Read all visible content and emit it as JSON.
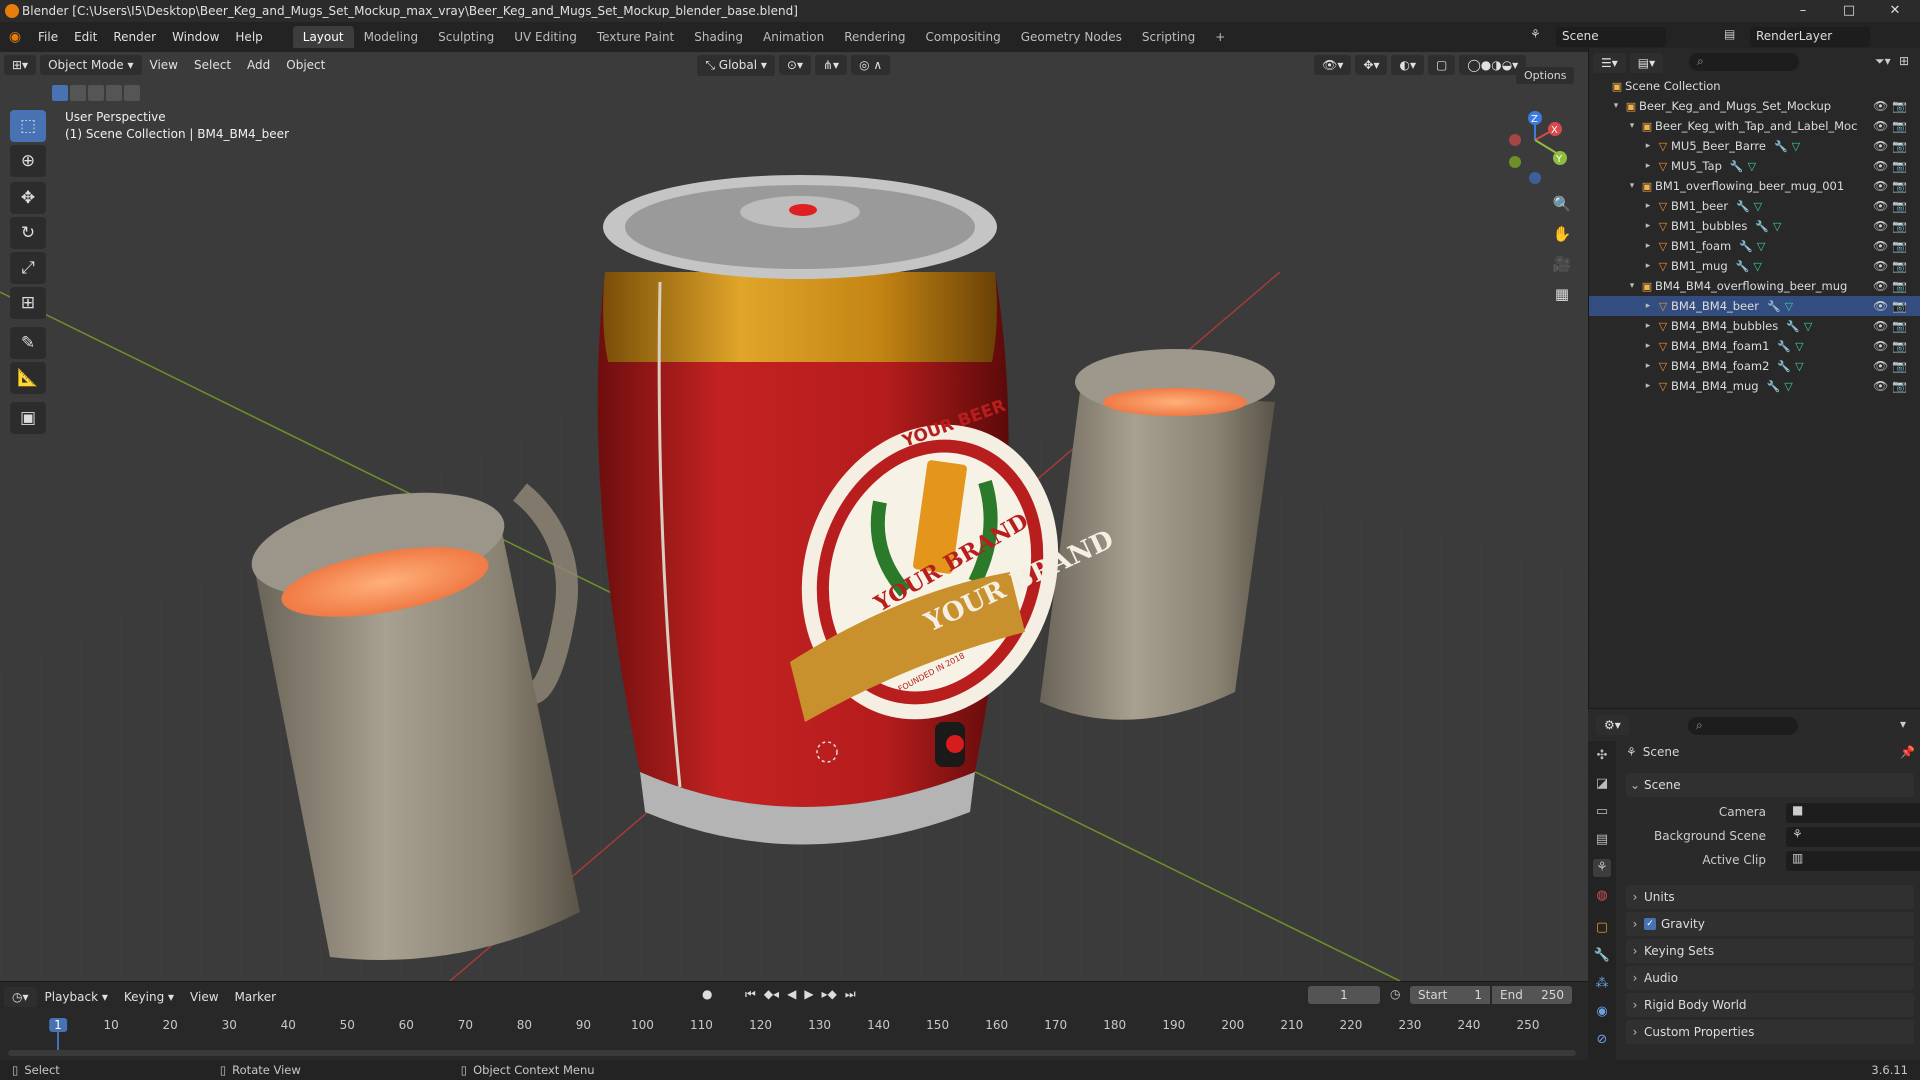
{
  "window": {
    "title": "Blender [C:\\Users\\I5\\Desktop\\Beer_Keg_and_Mugs_Set_Mockup_max_vray\\Beer_Keg_and_Mugs_Set_Mockup_blender_base.blend]",
    "minimize": "–",
    "maximize": "□",
    "close": "✕"
  },
  "menubar": {
    "menus": [
      "File",
      "Edit",
      "Render",
      "Window",
      "Help"
    ],
    "workspaces": [
      "Layout",
      "Modeling",
      "Sculpting",
      "UV Editing",
      "Texture Paint",
      "Shading",
      "Animation",
      "Rendering",
      "Compositing",
      "Geometry Nodes",
      "Scripting"
    ],
    "add_tab": "+",
    "scene_name": "Scene",
    "view_layer": "RenderLayer"
  },
  "viewport": {
    "mode": "Object Mode",
    "menus": [
      "View",
      "Select",
      "Add",
      "Object"
    ],
    "orientation": "Global",
    "options": "Options",
    "overlay_title": "User Perspective",
    "overlay_sub": "(1) Scene Collection | BM4_BM4_beer",
    "gizmo": {
      "x": "X",
      "y": "Y",
      "z": "Z"
    },
    "label_brand1": "YOUR BEER",
    "label_brand2": "YOUR BRAND",
    "label_brand3": "YOUR BRAND",
    "label_founded": "FOUNDED IN 2018"
  },
  "outliner": {
    "root": "Scene Collection",
    "rows": [
      {
        "label": "Beer_Keg_and_Mugs_Set_Mockup",
        "depth": 1,
        "type": "collection"
      },
      {
        "label": "Beer_Keg_with_Tap_and_Label_Moc",
        "depth": 2,
        "type": "collection"
      },
      {
        "label": "MU5_Beer_Barre",
        "depth": 3,
        "type": "object"
      },
      {
        "label": "MU5_Tap",
        "depth": 3,
        "type": "object"
      },
      {
        "label": "BM1_overflowing_beer_mug_001",
        "depth": 2,
        "type": "collection"
      },
      {
        "label": "BM1_beer",
        "depth": 3,
        "type": "object"
      },
      {
        "label": "BM1_bubbles",
        "depth": 3,
        "type": "object"
      },
      {
        "label": "BM1_foam",
        "depth": 3,
        "type": "object"
      },
      {
        "label": "BM1_mug",
        "depth": 3,
        "type": "object"
      },
      {
        "label": "BM4_BM4_overflowing_beer_mug",
        "depth": 2,
        "type": "collection"
      },
      {
        "label": "BM4_BM4_beer",
        "depth": 3,
        "type": "object"
      },
      {
        "label": "BM4_BM4_bubbles",
        "depth": 3,
        "type": "object"
      },
      {
        "label": "BM4_BM4_foam1",
        "depth": 3,
        "type": "object"
      },
      {
        "label": "BM4_BM4_foam2",
        "depth": 3,
        "type": "object"
      },
      {
        "label": "BM4_BM4_mug",
        "depth": 3,
        "type": "object"
      }
    ]
  },
  "properties": {
    "context": "Scene",
    "panel": "Scene",
    "camera_label": "Camera",
    "bg_scene_label": "Background Scene",
    "active_clip_label": "Active Clip",
    "sections": [
      "Units",
      "Gravity",
      "Keying Sets",
      "Audio",
      "Rigid Body World",
      "Custom Properties"
    ],
    "gravity_checked": true
  },
  "timeline": {
    "menus": [
      "Playback",
      "Keying",
      "View",
      "Marker"
    ],
    "current_frame": "1",
    "start_label": "Start",
    "start": "1",
    "end_label": "End",
    "end": "250",
    "ruler": [
      "1",
      "10",
      "20",
      "30",
      "40",
      "50",
      "60",
      "70",
      "80",
      "90",
      "100",
      "110",
      "120",
      "130",
      "140",
      "150",
      "160",
      "170",
      "180",
      "190",
      "200",
      "210",
      "220",
      "230",
      "240",
      "250"
    ]
  },
  "statusbar": {
    "select": "Select",
    "rotate": "Rotate View",
    "context_menu": "Object Context Menu",
    "version": "3.6.11"
  },
  "colors": {
    "accent": "#4772b3",
    "orange": "#f0902a",
    "keg_red": "#b91c1c"
  }
}
